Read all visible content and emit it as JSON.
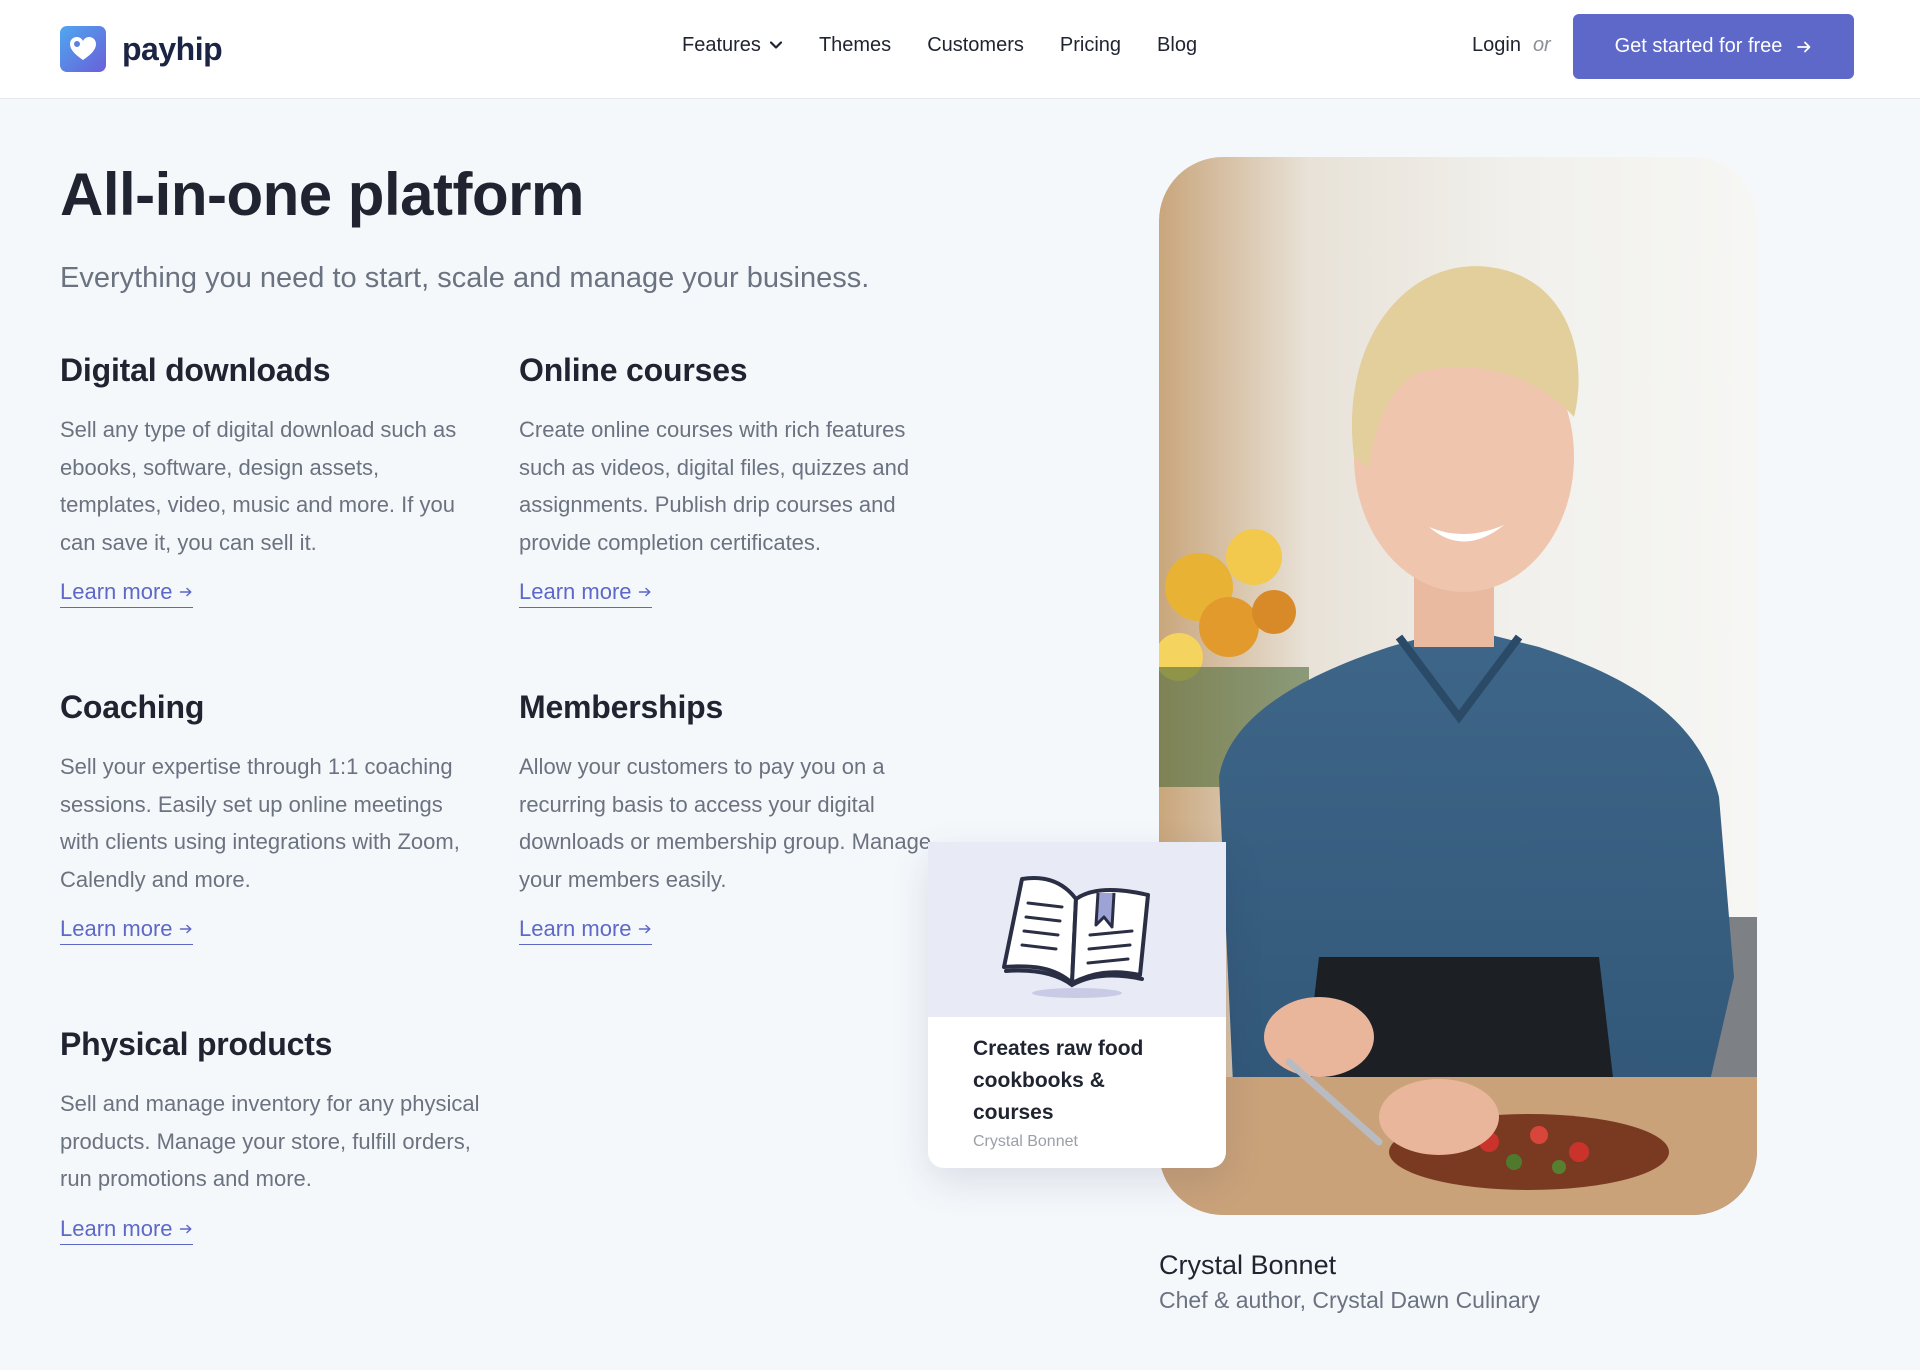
{
  "brand": {
    "name": "payhip"
  },
  "nav": {
    "items": [
      {
        "label": "Features",
        "has_dropdown": true
      },
      {
        "label": "Themes"
      },
      {
        "label": "Customers"
      },
      {
        "label": "Pricing"
      },
      {
        "label": "Blog"
      }
    ],
    "login_label": "Login",
    "or_label": "or",
    "cta_label": "Get started for free"
  },
  "hero": {
    "title": "All-in-one platform",
    "subtitle": "Everything you need to start, scale and manage your business."
  },
  "features": [
    {
      "title": "Digital downloads",
      "description": "Sell any type of digital download such as ebooks, software, design assets, templates, video, music and more. If you can save it, you can sell it.",
      "link_label": "Learn more"
    },
    {
      "title": "Online courses",
      "description": "Create online courses with rich features such as videos, digital files, quizzes and assignments. Publish drip courses and provide completion certificates.",
      "link_label": "Learn more"
    },
    {
      "title": "Coaching",
      "description": "Sell your expertise through 1:1 coaching sessions. Easily set up online meetings with clients using integrations with Zoom, Calendly and more.",
      "link_label": "Learn more"
    },
    {
      "title": "Memberships",
      "description": "Allow your customers to pay you on a recurring basis to access your digital downloads or membership group. Manage your members easily.",
      "link_label": "Learn more"
    },
    {
      "title": "Physical products",
      "description": "Sell and manage inventory for any physical products. Manage your store, fulfill orders, run promotions and more.",
      "link_label": "Learn more"
    }
  ],
  "testimonial_card": {
    "icon": "open-book-icon",
    "title": "Creates raw food cookbooks & courses",
    "author": "Crystal Bonnet"
  },
  "testimonial": {
    "name": "Crystal Bonnet",
    "role": "Chef & author, Crystal Dawn Culinary"
  },
  "colors": {
    "accent": "#5d68c8",
    "brand_dark": "#1b2444",
    "background": "#f5f8fb",
    "card_tint": "#e8eaf6"
  }
}
